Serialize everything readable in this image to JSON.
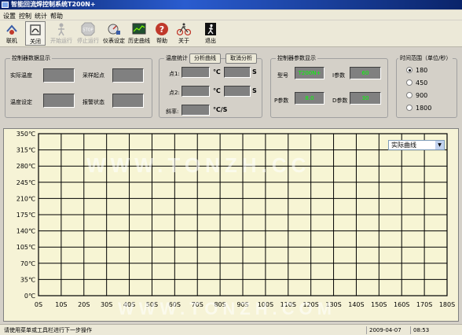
{
  "window": {
    "title": "智能回流焊控制系统T200N+"
  },
  "menu": [
    "设置",
    "控制",
    "统计",
    "帮助"
  ],
  "toolbar": [
    {
      "label": "联机",
      "icon": "connect-icon",
      "state": "normal"
    },
    {
      "label": "关闭",
      "icon": "close-conn-icon",
      "state": "pressed"
    },
    {
      "label": "开始运行",
      "icon": "start-icon",
      "state": "disabled"
    },
    {
      "label": "停止运行",
      "icon": "stop-icon",
      "state": "disabled"
    },
    {
      "label": "仪表设定",
      "icon": "meter-settings-icon",
      "state": "normal"
    },
    {
      "label": "历史曲线",
      "icon": "history-curve-icon",
      "state": "normal"
    },
    {
      "label": "帮助",
      "icon": "help-icon",
      "state": "normal"
    },
    {
      "label": "关于",
      "icon": "about-icon",
      "state": "normal"
    },
    {
      "label": "退出",
      "icon": "exit-icon",
      "state": "normal"
    }
  ],
  "controller_data": {
    "title": "控制器数据显示",
    "actual_temp": "实际温度",
    "sample_start": "采样起点",
    "temp_setting": "温度设定",
    "alarm_status": "报警状态"
  },
  "temp_stats": {
    "title": "温度统计",
    "analyze_button": "分析曲线",
    "cancel_button": "取消分析",
    "point1": "点1:",
    "point2": "点2:",
    "slope": "斜率:",
    "unit_c": "℃",
    "unit_s": "S",
    "unit_cs": "℃/S"
  },
  "controller_params": {
    "title": "控制器参数显示",
    "model_label": "型号",
    "model_value": "T200N+",
    "i_label": "I参数",
    "i_value": "60",
    "p_label": "P参数",
    "p_value": "8.0",
    "d_label": "D参数",
    "d_value": "30"
  },
  "time_range": {
    "title": "时间范围（单位/秒）",
    "options": [
      "180",
      "450",
      "900",
      "1800"
    ],
    "selected": "180"
  },
  "curve_select": {
    "value": "实际曲线"
  },
  "watermark": {
    "top": "WWW.TONZH.CC",
    "bottom": "WWW.TONZH.COM"
  },
  "status": {
    "message": "请使用菜单或工具栏进行下一步操作",
    "date": "2009-04-07",
    "time": "08:53"
  },
  "chart_data": {
    "type": "line",
    "title": "",
    "xlabel": "",
    "ylabel": "",
    "x_ticks": [
      "0S",
      "10S",
      "20S",
      "30S",
      "40S",
      "50S",
      "60S",
      "70S",
      "80S",
      "90S",
      "100S",
      "110S",
      "120S",
      "130S",
      "140S",
      "150S",
      "160S",
      "170S",
      "180S"
    ],
    "y_ticks": [
      "0℃",
      "35℃",
      "70℃",
      "105℃",
      "140℃",
      "175℃",
      "210℃",
      "245℃",
      "280℃",
      "315℃",
      "350℃"
    ],
    "xlim": [
      0,
      180
    ],
    "ylim": [
      0,
      350
    ],
    "grid": true,
    "series": []
  }
}
